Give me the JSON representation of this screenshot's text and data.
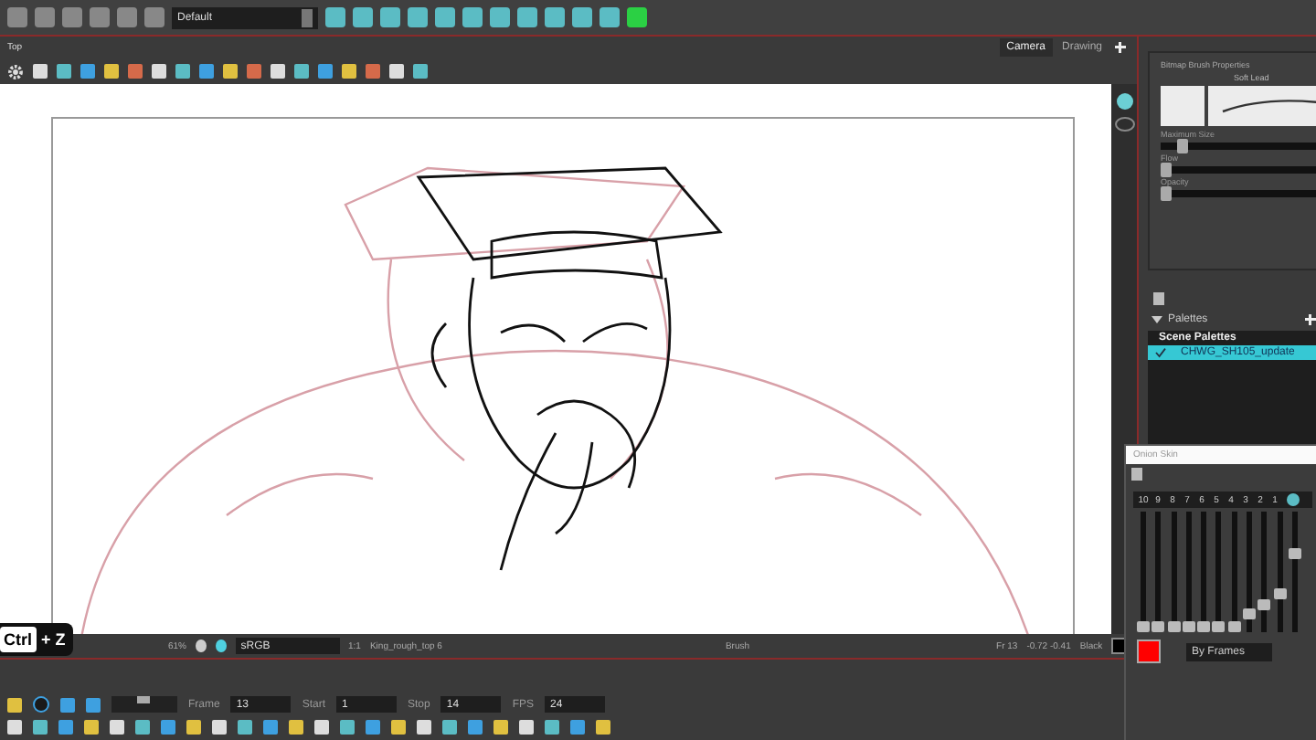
{
  "toolbar": {
    "workspace": "Default"
  },
  "view": {
    "title": "Top",
    "tabs": [
      {
        "label": "Camera",
        "selected": true
      },
      {
        "label": "Drawing",
        "selected": false
      }
    ]
  },
  "status_bar": {
    "zoom": "61%",
    "color_space": "sRGB",
    "drawing_ratio": "1:1",
    "drawing": "King_rough_top 6",
    "tool": "Brush",
    "frame": "Fr 13",
    "coordinates": "-0.72 -0.41",
    "color_name": "Black"
  },
  "keystroke": {
    "key": "Ctrl",
    "combo": "+ Z"
  },
  "timeline": {
    "fields": [
      {
        "label": "Frame",
        "value": "13"
      },
      {
        "label": "Start",
        "value": "1"
      },
      {
        "label": "Stop",
        "value": "14"
      },
      {
        "label": "FPS",
        "value": "24"
      }
    ],
    "loop": true,
    "speed": {
      "level": 0.5
    }
  },
  "brush_properties": {
    "title": "Bitmap Brush Properties",
    "preset": "Soft Lead",
    "sliders": [
      {
        "label": "Maximum Size",
        "level": 0.1
      },
      {
        "label": "Flow",
        "level": 0
      },
      {
        "label": "Opacity",
        "level": 0
      }
    ]
  },
  "palettes": {
    "title": "Palettes",
    "section": "Scene Palettes",
    "items": [
      {
        "name": "CHWG_SH105_update",
        "checked": true,
        "selected": true
      }
    ]
  },
  "onion_skin": {
    "title": "Onion Skin",
    "mode": "By Frames",
    "color": "#ff0000",
    "frames": [
      {
        "label": "10",
        "level": 0
      },
      {
        "label": "9",
        "level": 0
      },
      {
        "label": "8",
        "level": 0
      },
      {
        "label": "7",
        "level": 0
      },
      {
        "label": "6",
        "level": 0
      },
      {
        "label": "5",
        "level": 0
      },
      {
        "label": "4",
        "level": 0
      },
      {
        "label": "3",
        "level": 0.12
      },
      {
        "label": "2",
        "level": 0.22
      },
      {
        "label": "1",
        "level": 0.32
      }
    ],
    "current": {
      "level": 0.72
    }
  }
}
